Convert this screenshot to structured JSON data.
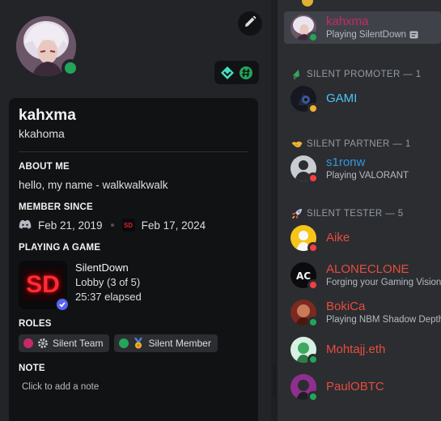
{
  "profile": {
    "display_name": "kahxma",
    "username": "kkahoma",
    "about_title": "ABOUT ME",
    "about_text": "hello, my name - walkwalkwalk",
    "member_since_title": "MEMBER SINCE",
    "discord_since": "Feb 21, 2019",
    "server_since": "Feb 17, 2024",
    "server_icon_text": "SD",
    "playing_title": "PLAYING A GAME",
    "game": {
      "icon_text": "SD",
      "name": "SilentDown",
      "state": "Lobby (3 of 5)",
      "elapsed": "25:37 elapsed"
    },
    "roles_title": "ROLES",
    "roles": [
      {
        "name": "Silent Team",
        "color": "#c72a68",
        "icon": "gear-icon"
      },
      {
        "name": "Silent Member",
        "color": "#23a55a",
        "icon": "medal-icon"
      }
    ],
    "note_title": "NOTE",
    "note_placeholder": "Click to add a note"
  },
  "members": {
    "selected": {
      "name": "kahxma",
      "activity": "Playing SilentDown",
      "name_color": "#c72a68"
    },
    "categories": [
      {
        "title": "SILENT PROMOTER — 1",
        "icon": "speaker-icon",
        "members": [
          {
            "name": "GAMI",
            "activity": "",
            "name_color": "#4fc3f7",
            "status": "idle"
          }
        ]
      },
      {
        "title": "SILENT PARTNER — 1",
        "icon": "handshake-icon",
        "members": [
          {
            "name": "s1ronw",
            "activity": "Playing VALORANT",
            "name_color": "#3498db",
            "status": "dnd"
          }
        ]
      },
      {
        "title": "SILENT TESTER — 5",
        "icon": "rocket-icon",
        "members": [
          {
            "name": "Aike",
            "activity": "",
            "name_color": "#e74c3c",
            "status": "dnd"
          },
          {
            "name": "ALONECLONE",
            "activity": "Forging your Gaming Vision",
            "name_color": "#e74c3c",
            "status": "dnd"
          },
          {
            "name": "BokiCa",
            "activity": "Playing NBM Shadow Depth",
            "name_color": "#e74c3c",
            "status": "online"
          },
          {
            "name": "Mohtajj.eth",
            "activity": "",
            "name_color": "#e74c3c",
            "status": "online"
          },
          {
            "name": "PaulOBTC",
            "activity": "",
            "name_color": "#e74c3c",
            "status": "online"
          }
        ]
      }
    ]
  },
  "colors": {
    "online": "#23a55a",
    "dnd": "#f23f43",
    "idle": "#f0b232",
    "blurple": "#5865f2"
  }
}
